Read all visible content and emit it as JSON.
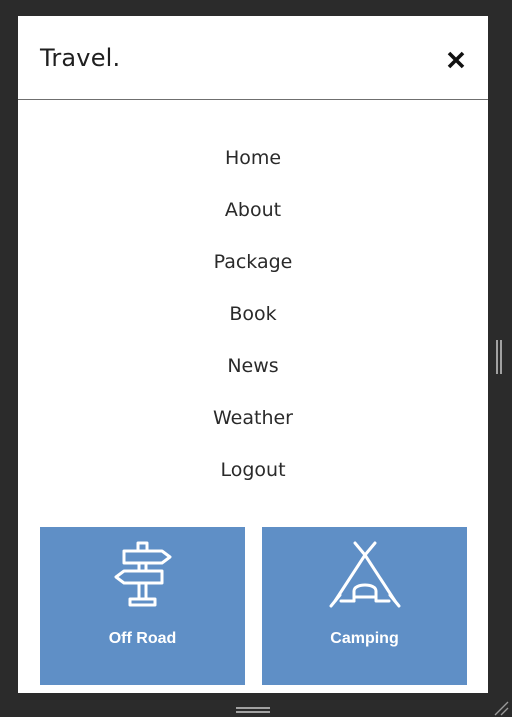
{
  "header": {
    "brand": "Travel.",
    "close_icon": "close-icon"
  },
  "nav": {
    "items": [
      {
        "label": "Home"
      },
      {
        "label": "About"
      },
      {
        "label": "Package"
      },
      {
        "label": "Book"
      },
      {
        "label": "News"
      },
      {
        "label": "Weather"
      },
      {
        "label": "Logout"
      }
    ]
  },
  "cards": [
    {
      "label": "Off Road",
      "icon": "signpost-icon"
    },
    {
      "label": "Camping",
      "icon": "tent-icon"
    }
  ],
  "colors": {
    "accent": "#5f8fc6",
    "panel": "#ffffff",
    "frame": "#2b2b2b"
  }
}
